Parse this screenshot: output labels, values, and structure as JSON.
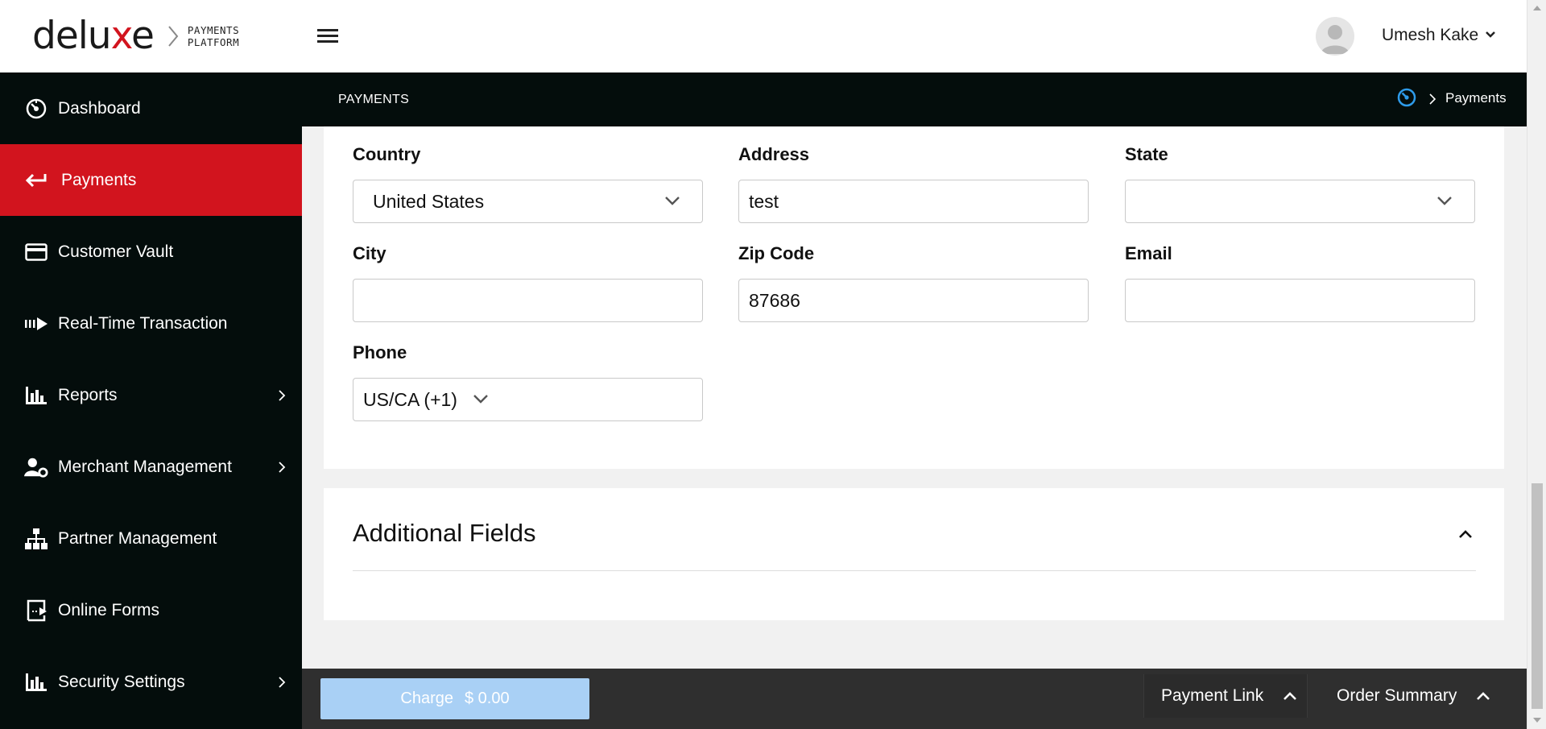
{
  "brand": {
    "logo_word_pre": "delu",
    "logo_word_x": "x",
    "logo_word_post": "e",
    "sub_line1": "PAYMENTS",
    "sub_line2": "PLATFORM",
    "accent_color": "#d2141e"
  },
  "header": {
    "menu_icon": "hamburger-icon",
    "user_name": "Umesh Kake",
    "user_caret_icon": "chevron-down-icon"
  },
  "sidebar": {
    "items": [
      {
        "label": "Dashboard",
        "icon": "dashboard-gauge-icon",
        "active": false,
        "has_submenu": false
      },
      {
        "label": "Payments",
        "icon": "arrow-left-icon",
        "active": true,
        "has_submenu": false
      },
      {
        "label": "Customer Vault",
        "icon": "credit-card-icon",
        "active": false,
        "has_submenu": false
      },
      {
        "label": "Real-Time Transaction",
        "icon": "transaction-arrow-icon",
        "active": false,
        "has_submenu": false
      },
      {
        "label": "Reports",
        "icon": "bar-chart-icon",
        "active": false,
        "has_submenu": true
      },
      {
        "label": "Merchant Management",
        "icon": "user-gear-icon",
        "active": false,
        "has_submenu": true
      },
      {
        "label": "Partner Management",
        "icon": "org-chart-icon",
        "active": false,
        "has_submenu": false
      },
      {
        "label": "Online Forms",
        "icon": "online-form-icon",
        "active": false,
        "has_submenu": false
      },
      {
        "label": "Security Settings",
        "icon": "bar-chart-icon",
        "active": false,
        "has_submenu": true
      }
    ]
  },
  "subheader": {
    "title": "PAYMENTS",
    "breadcrumb_icon": "dashboard-gauge-icon",
    "breadcrumb_label": "Payments"
  },
  "form": {
    "country": {
      "label": "Country",
      "value": "United States"
    },
    "address": {
      "label": "Address",
      "value": "test"
    },
    "state": {
      "label": "State",
      "value": ""
    },
    "city": {
      "label": "City",
      "value": ""
    },
    "zip": {
      "label": "Zip Code",
      "value": "87686"
    },
    "email": {
      "label": "Email",
      "value": ""
    },
    "phone": {
      "label": "Phone",
      "value": "US/CA (+1)"
    }
  },
  "additional_fields": {
    "title": "Additional Fields",
    "expanded": true
  },
  "bottom_bar": {
    "charge_label": "Charge",
    "charge_amount": "$ 0.00",
    "charge_color": "#a9d0f5",
    "payment_link_label": "Payment Link",
    "order_summary_label": "Order Summary"
  }
}
